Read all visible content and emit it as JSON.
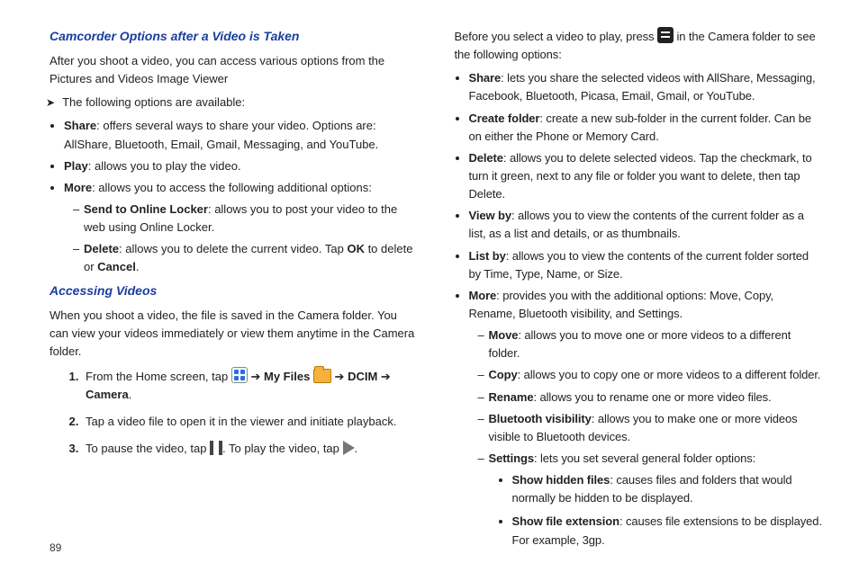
{
  "left": {
    "h1": "Camcorder Options after a Video is Taken",
    "intro": "After you shoot a video, you can access various options from the Pictures and Videos Image Viewer",
    "availLine": "The following options are available:",
    "share": {
      "term": "Share",
      "text": ": offers several ways to share your video. Options are: AllShare, Bluetooth, Email, Gmail, Messaging, and YouTube."
    },
    "play": {
      "term": "Play",
      "text": ": allows you to play the video."
    },
    "more": {
      "term": "More",
      "text": ": allows you to access the following additional options:"
    },
    "more_send": {
      "term": "Send to Online Locker",
      "text": ": allows you to post your video to the web using Online Locker."
    },
    "more_del_pre": {
      "term": "Delete",
      "text_a": ": allows you to delete the current video. Tap ",
      "ok": "OK",
      "text_b": " to delete or ",
      "cancel": "Cancel",
      "tail": "."
    },
    "h2": "Accessing Videos",
    "access_p": "When you shoot a video, the file is saved in the Camera folder. You can view your videos immediately or view them anytime in the Camera folder.",
    "step1_a": "From the Home screen, tap ",
    "arrow": "➔",
    "step1_myfiles": "My Files",
    "step1_dcim": "DCIM",
    "step1_camera": "Camera",
    "step2": "Tap a video file to open it in the viewer and initiate playback.",
    "step3_a": "To pause the video, tap ",
    "step3_b": ". To play the video, tap ",
    "step3_tail": "."
  },
  "right": {
    "intro_a": "Before you select a video to play, press ",
    "intro_b": " in the Camera folder to see the following options:",
    "share": {
      "term": "Share",
      "text": ": lets you share the selected videos with AllShare, Messaging, Facebook, Bluetooth, Picasa, Email, Gmail, or YouTube."
    },
    "create": {
      "term": "Create folder",
      "text": ": create a new sub-folder in the current folder. Can be on either the Phone or Memory Card."
    },
    "delete": {
      "term": "Delete",
      "text": ": allows you to delete selected videos. Tap the checkmark, to turn it green, next to any file or folder you want to delete, then tap Delete."
    },
    "viewby": {
      "term": "View by",
      "text": ": allows you to view the contents of the current folder as a list, as a list and details, or as thumbnails."
    },
    "listby": {
      "term": "List by",
      "text": ": allows you to view the contents of the current folder sorted by Time, Type, Name, or Size."
    },
    "more": {
      "term": "More",
      "text": ": provides you with the additional options: Move, Copy, Rename, Bluetooth visibility, and Settings."
    },
    "mv": {
      "term": "Move",
      "text": ": allows you to move one or more videos to a different folder."
    },
    "cp": {
      "term": "Copy",
      "text": ": allows you to copy one or more videos to a different folder."
    },
    "rn": {
      "term": "Rename",
      "text": ": allows you to rename one or more video files."
    },
    "bt": {
      "term": "Bluetooth visibility",
      "text": ": allows you to make one or more videos visible to Bluetooth devices."
    },
    "st": {
      "term": "Settings",
      "text": ": lets you set several general folder options:"
    },
    "shf": {
      "term": "Show hidden files",
      "text": ": causes files and folders that would normally be hidden to be displayed."
    },
    "sfe": {
      "term": "Show file extension",
      "text": ": causes file extensions to be displayed. For example, 3gp."
    }
  },
  "pageNumber": "89"
}
